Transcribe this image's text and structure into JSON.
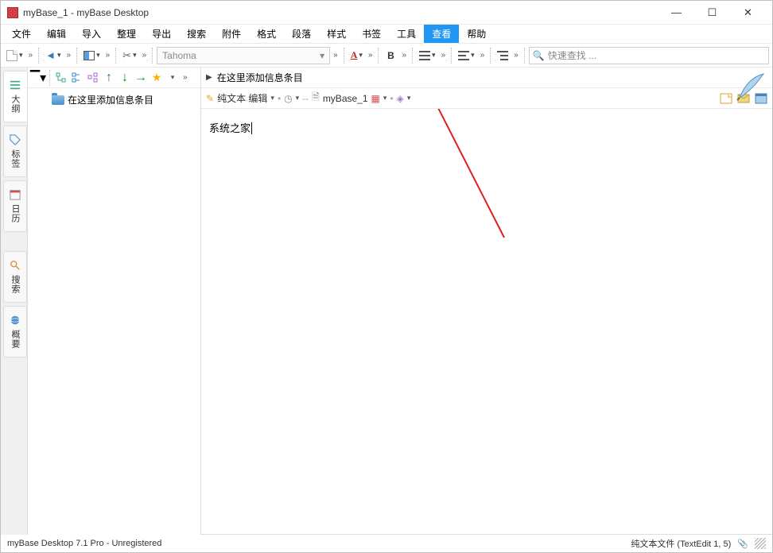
{
  "window": {
    "title": "myBase_1 - myBase Desktop"
  },
  "menu": {
    "file": "文件",
    "edit": "编辑",
    "import": "导入",
    "organize": "整理",
    "export": "导出",
    "search": "搜索",
    "attach": "附件",
    "format": "格式",
    "paragraph": "段落",
    "style": "样式",
    "bookmark": "书签",
    "tools": "工具",
    "view": "查看",
    "help": "帮助"
  },
  "toolbar": {
    "font": "Tahoma",
    "bold": "B",
    "fontA": "A",
    "search_placeholder": "快速查找 ..."
  },
  "vtabs": {
    "outline": "大纲",
    "tags": "标签",
    "calendar": "日历",
    "search": "搜索",
    "overview": "概要"
  },
  "tree": {
    "root": "在这里添加信息条目"
  },
  "content": {
    "breadcrumb": "在这里添加信息条目",
    "mode": "纯文本 编辑",
    "db": "myBase_1",
    "text": "系统之家"
  },
  "status": {
    "left": "myBase Desktop 7.1 Pro - Unregistered",
    "right": "纯文本文件 (TextEdit 1, 5)"
  }
}
